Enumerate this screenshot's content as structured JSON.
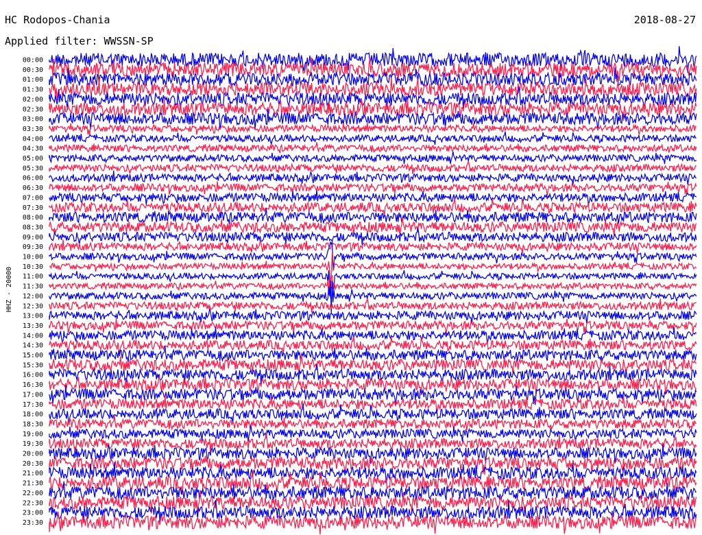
{
  "header": {
    "station": "HC Rodopos-Chania",
    "date": "2018-08-27",
    "filter": "Applied filter: WWSSN-SP"
  },
  "colors": {
    "background": "#ffffff",
    "trace_a": "#0000ee",
    "trace_b": "#ff1a48"
  },
  "chart_data": {
    "type": "line",
    "ylabel": "HHZ - 20000",
    "rows": [
      "00:00",
      "00:30",
      "01:00",
      "01:30",
      "02:00",
      "02:30",
      "03:00",
      "03:30",
      "04:00",
      "04:30",
      "05:00",
      "05:30",
      "06:00",
      "06:30",
      "07:00",
      "07:30",
      "08:00",
      "08:30",
      "09:00",
      "09:30",
      "10:00",
      "10:30",
      "11:00",
      "11:30",
      "12:00",
      "12:30",
      "13:00",
      "13:30",
      "14:00",
      "14:30",
      "15:00",
      "15:30",
      "16:00",
      "16:30",
      "17:00",
      "17:30",
      "18:00",
      "18:30",
      "19:00",
      "19:30",
      "20:00",
      "20:30",
      "21:00",
      "21:30",
      "22:00",
      "22:30",
      "23:00",
      "23:30"
    ],
    "trace_colors": [
      "blue",
      "red",
      "blue",
      "red",
      "blue",
      "red",
      "blue",
      "red",
      "blue",
      "red",
      "blue",
      "red",
      "blue",
      "red",
      "blue",
      "red",
      "blue",
      "red",
      "blue",
      "red",
      "blue",
      "red",
      "blue",
      "red",
      "blue",
      "red",
      "blue",
      "red",
      "blue",
      "red",
      "blue",
      "red",
      "blue",
      "red",
      "blue",
      "red",
      "blue",
      "red",
      "blue",
      "red",
      "blue",
      "red",
      "blue",
      "red",
      "blue",
      "red",
      "blue",
      "red"
    ],
    "noise_level": [
      1.6,
      1.6,
      1.5,
      1.5,
      1.5,
      1.5,
      1.4,
      0.8,
      0.8,
      0.8,
      0.8,
      0.85,
      0.9,
      0.9,
      1.0,
      1.1,
      1.2,
      1.2,
      1.1,
      0.9,
      0.8,
      0.7,
      0.7,
      0.7,
      0.8,
      0.9,
      1.0,
      1.0,
      1.1,
      1.1,
      1.2,
      1.3,
      1.3,
      1.3,
      1.3,
      1.2,
      1.2,
      1.1,
      1.1,
      1.2,
      1.3,
      1.4,
      1.4,
      1.5,
      1.5,
      1.5,
      1.5,
      1.5
    ],
    "event": {
      "start_row": "10:00",
      "end_row": "12:00",
      "position": 0.435
    }
  }
}
